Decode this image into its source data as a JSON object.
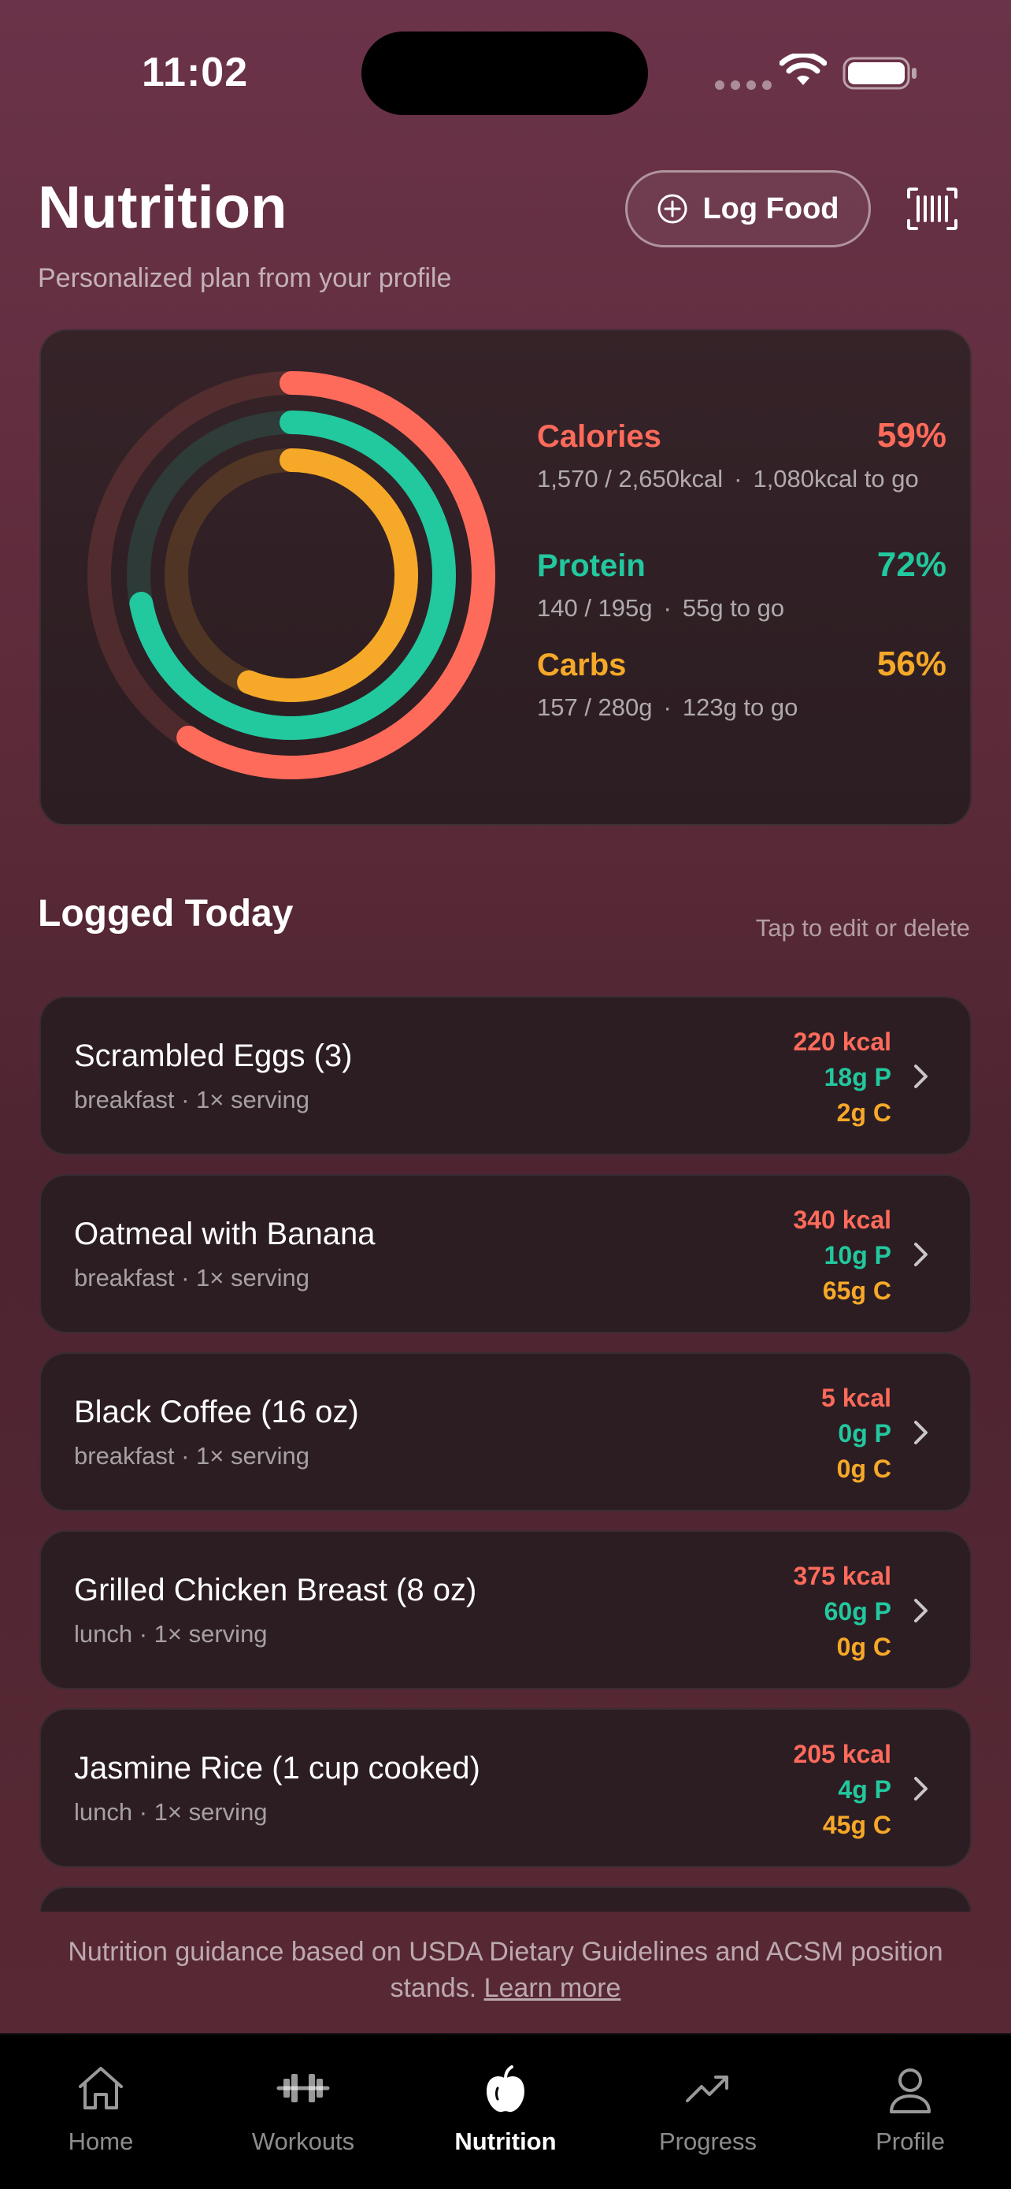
{
  "status_bar": {
    "time": "11:02"
  },
  "header": {
    "title": "Nutrition",
    "subtitle": "Personalized plan from your profile",
    "log_food_label": "Log Food",
    "icons": {
      "log_food": "plus-circle-icon",
      "scan": "barcode-icon"
    }
  },
  "summary": {
    "calories": {
      "label": "Calories",
      "percent_label": "59%",
      "progress": 0.59,
      "consumed": "1,570 / 2,650kcal",
      "remaining": "1,080kcal to go",
      "color": "#ff6b5b"
    },
    "protein": {
      "label": "Protein",
      "percent_label": "72%",
      "progress": 0.72,
      "consumed": "140 / 195g",
      "remaining": "55g to go",
      "color": "#22c89e"
    },
    "carbs": {
      "label": "Carbs",
      "percent_label": "56%",
      "progress": 0.56,
      "consumed": "157 / 280g",
      "remaining": "123g to go",
      "color": "#f6a928"
    }
  },
  "logged": {
    "title": "Logged Today",
    "hint": "Tap to edit or delete",
    "items": [
      {
        "name": "Scrambled Eggs (3)",
        "meta": "breakfast · 1× serving",
        "kcal": "220 kcal",
        "protein": "18g P",
        "carbs": "2g C"
      },
      {
        "name": "Oatmeal with Banana",
        "meta": "breakfast · 1× serving",
        "kcal": "340 kcal",
        "protein": "10g P",
        "carbs": "65g C"
      },
      {
        "name": "Black Coffee (16 oz)",
        "meta": "breakfast · 1× serving",
        "kcal": "5 kcal",
        "protein": "0g P",
        "carbs": "0g C"
      },
      {
        "name": "Grilled Chicken Breast (8 oz)",
        "meta": "lunch · 1× serving",
        "kcal": "375 kcal",
        "protein": "60g P",
        "carbs": "0g C"
      },
      {
        "name": "Jasmine Rice (1 cup cooked)",
        "meta": "lunch · 1× serving",
        "kcal": "205 kcal",
        "protein": "4g P",
        "carbs": "45g C"
      }
    ]
  },
  "footer": {
    "note": "Nutrition guidance based on USDA Dietary Guidelines and ACSM position stands.",
    "link": "Learn more"
  },
  "tabs": [
    {
      "label": "Home",
      "icon": "house-icon",
      "active": false
    },
    {
      "label": "Workouts",
      "icon": "dumbbell-icon",
      "active": false
    },
    {
      "label": "Nutrition",
      "icon": "apple-icon",
      "active": true
    },
    {
      "label": "Progress",
      "icon": "trend-up-icon",
      "active": false
    },
    {
      "label": "Profile",
      "icon": "person-icon",
      "active": false
    }
  ],
  "colors": {
    "calories": "#ff6b5b",
    "protein": "#22c89e",
    "carbs": "#f6a928",
    "card": "#2c1d23",
    "background": "#5b2a38"
  }
}
